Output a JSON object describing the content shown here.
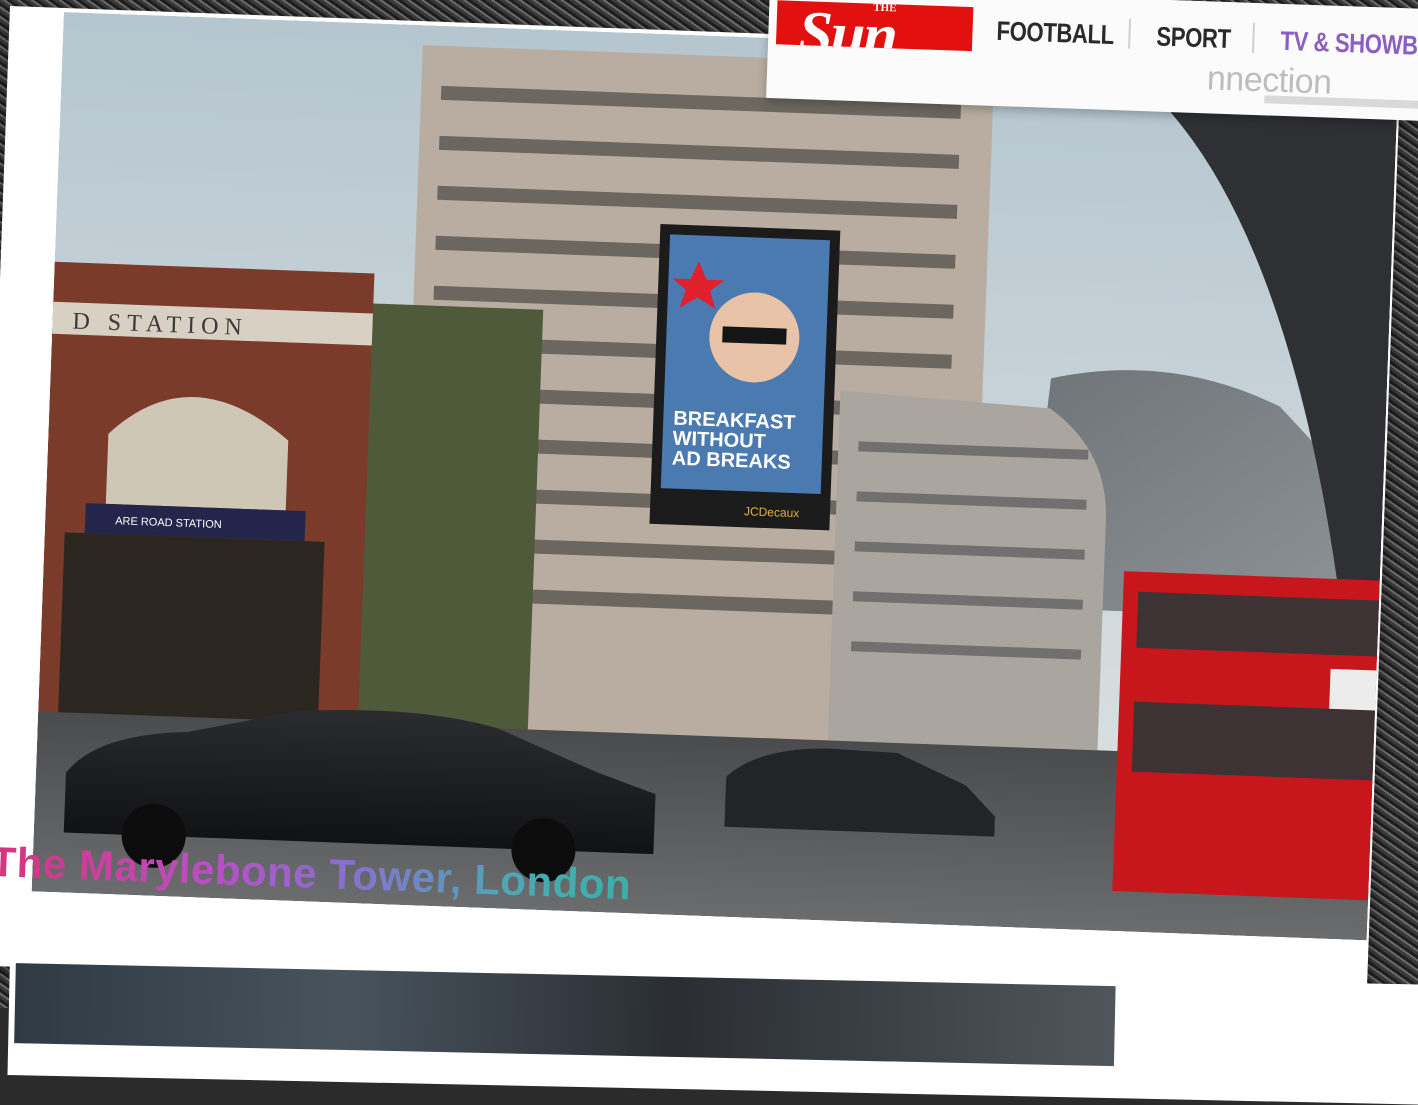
{
  "navigation": {
    "logo_the": "THE",
    "logo_sun": "Sun",
    "items": [
      {
        "label": "FOOTBALL"
      },
      {
        "label": "SPORT"
      },
      {
        "label": "TV & SHOWBI"
      }
    ],
    "sub_heading_fragment": "nnection"
  },
  "photo": {
    "station_sign": "D STATION",
    "station_banner": "ARE ROAD STATION",
    "billboard": {
      "headline_lines": [
        "BREAKFAST",
        "WITHOUT",
        "AD BREAKS"
      ],
      "operator": "JCDecaux"
    },
    "caption": "The Marylebone Tower, London"
  },
  "colors": {
    "sun_red": "#e2110f",
    "bus_red": "#c8161d",
    "caption_start": "#d6347a",
    "caption_end": "#39b1a6"
  }
}
